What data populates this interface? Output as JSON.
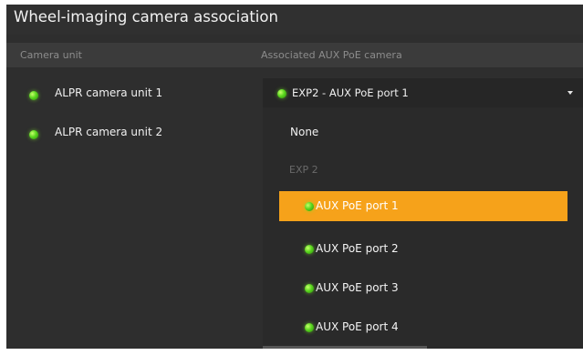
{
  "window": {
    "title": "Wheel-imaging camera association"
  },
  "table": {
    "columns": [
      "Camera unit",
      "Associated AUX PoE camera"
    ],
    "camera_units": [
      {
        "label": "ALPR camera unit 1",
        "status_color": "#5ad41e"
      },
      {
        "label": "ALPR camera unit 2",
        "status_color": "#5ad41e"
      }
    ]
  },
  "association_select": {
    "selected_label": "EXP2  - AUX PoE port 1"
  },
  "dropdown": {
    "none_label": "None",
    "group_label": "EXP 2",
    "options": [
      {
        "label": "AUX PoE port 1",
        "selected": true
      },
      {
        "label": "AUX PoE port 2",
        "selected": false
      },
      {
        "label": "AUX PoE port 3",
        "selected": false
      },
      {
        "label": "AUX PoE port 4",
        "selected": false
      }
    ]
  },
  "colors": {
    "accent": "#f6a21a",
    "panel_bg": "#2e2e2e",
    "header_bg": "#3b3b3b",
    "status_online": "#5ad41e"
  }
}
